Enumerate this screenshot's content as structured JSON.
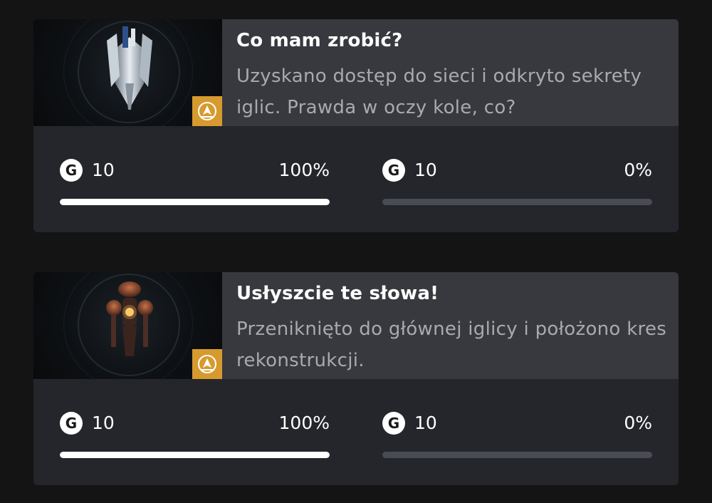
{
  "achievements": [
    {
      "title": "Co mam zrobić?",
      "description": "Uzyskano dostęp do sieci i odkryto sekrety iglic. Prawda w oczy kole, co?",
      "image_icon": "sentinel-ship-icon",
      "badge_icon": "rare-achievement-icon",
      "stats": [
        {
          "points": "10",
          "percent_label": "100%",
          "progress": 1.0
        },
        {
          "points": "10",
          "percent_label": "0%",
          "progress": 0.0
        }
      ]
    },
    {
      "title": "Usłyszcie te słowa!",
      "description": "Przeniknięto do głównej iglicy i położono kres rekonstrukcji.",
      "image_icon": "sentinel-robot-icon",
      "badge_icon": "rare-achievement-icon",
      "stats": [
        {
          "points": "10",
          "percent_label": "100%",
          "progress": 1.0
        },
        {
          "points": "10",
          "percent_label": "0%",
          "progress": 0.0
        }
      ]
    }
  ],
  "gamerscore_icon_letter": "G",
  "colors": {
    "background": "#141414",
    "card": "#25262b",
    "info_panel": "#38393e",
    "badge": "#d79a2e",
    "bar_track": "#4a4c53",
    "bar_fill": "#ffffff"
  }
}
